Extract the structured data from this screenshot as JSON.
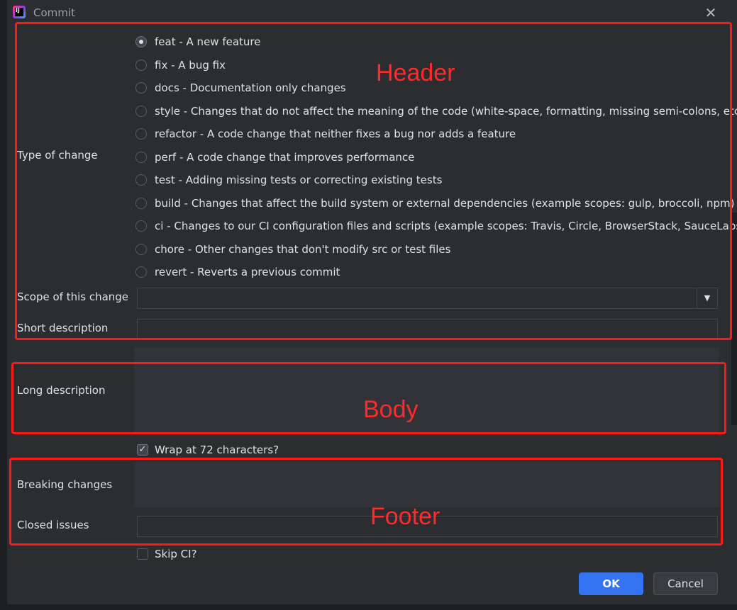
{
  "window": {
    "title": "Commit",
    "close_icon": "close-icon"
  },
  "labels": {
    "type_of_change": "Type of change",
    "scope": "Scope of this change",
    "short_description": "Short description",
    "long_description": "Long description",
    "breaking_changes": "Breaking changes",
    "closed_issues": "Closed issues"
  },
  "type_options": [
    {
      "label": "feat - A new feature",
      "selected": true
    },
    {
      "label": "fix - A bug fix",
      "selected": false
    },
    {
      "label": "docs - Documentation only changes",
      "selected": false
    },
    {
      "label": "style - Changes that do not affect the meaning of the code (white-space, formatting, missing semi-colons, etc)",
      "selected": false
    },
    {
      "label": "refactor - A code change that neither fixes a bug nor adds a feature",
      "selected": false
    },
    {
      "label": "perf - A code change that improves performance",
      "selected": false
    },
    {
      "label": "test - Adding missing tests or correcting existing tests",
      "selected": false
    },
    {
      "label": "build - Changes that affect the build system or external dependencies (example scopes: gulp, broccoli, npm)",
      "selected": false
    },
    {
      "label": "ci - Changes to our CI configuration files and scripts (example scopes: Travis, Circle, BrowserStack, SauceLabs)",
      "selected": false
    },
    {
      "label": "chore - Other changes that don't modify src or test files",
      "selected": false
    },
    {
      "label": "revert - Reverts a previous commit",
      "selected": false
    }
  ],
  "fields": {
    "scope_value": "",
    "short_description_value": "",
    "long_description_value": "",
    "breaking_changes_value": "",
    "closed_issues_value": ""
  },
  "checkboxes": {
    "wrap": {
      "label": "Wrap at 72 characters?",
      "checked": true
    },
    "skip_ci": {
      "label": "Skip CI?",
      "checked": false
    }
  },
  "buttons": {
    "ok": "OK",
    "cancel": "Cancel"
  },
  "annotations": {
    "header": "Header",
    "body": "Body",
    "footer": "Footer",
    "color": "#ff1a1a"
  },
  "colors": {
    "accent": "#3574f0",
    "background": "#2b2d30"
  }
}
